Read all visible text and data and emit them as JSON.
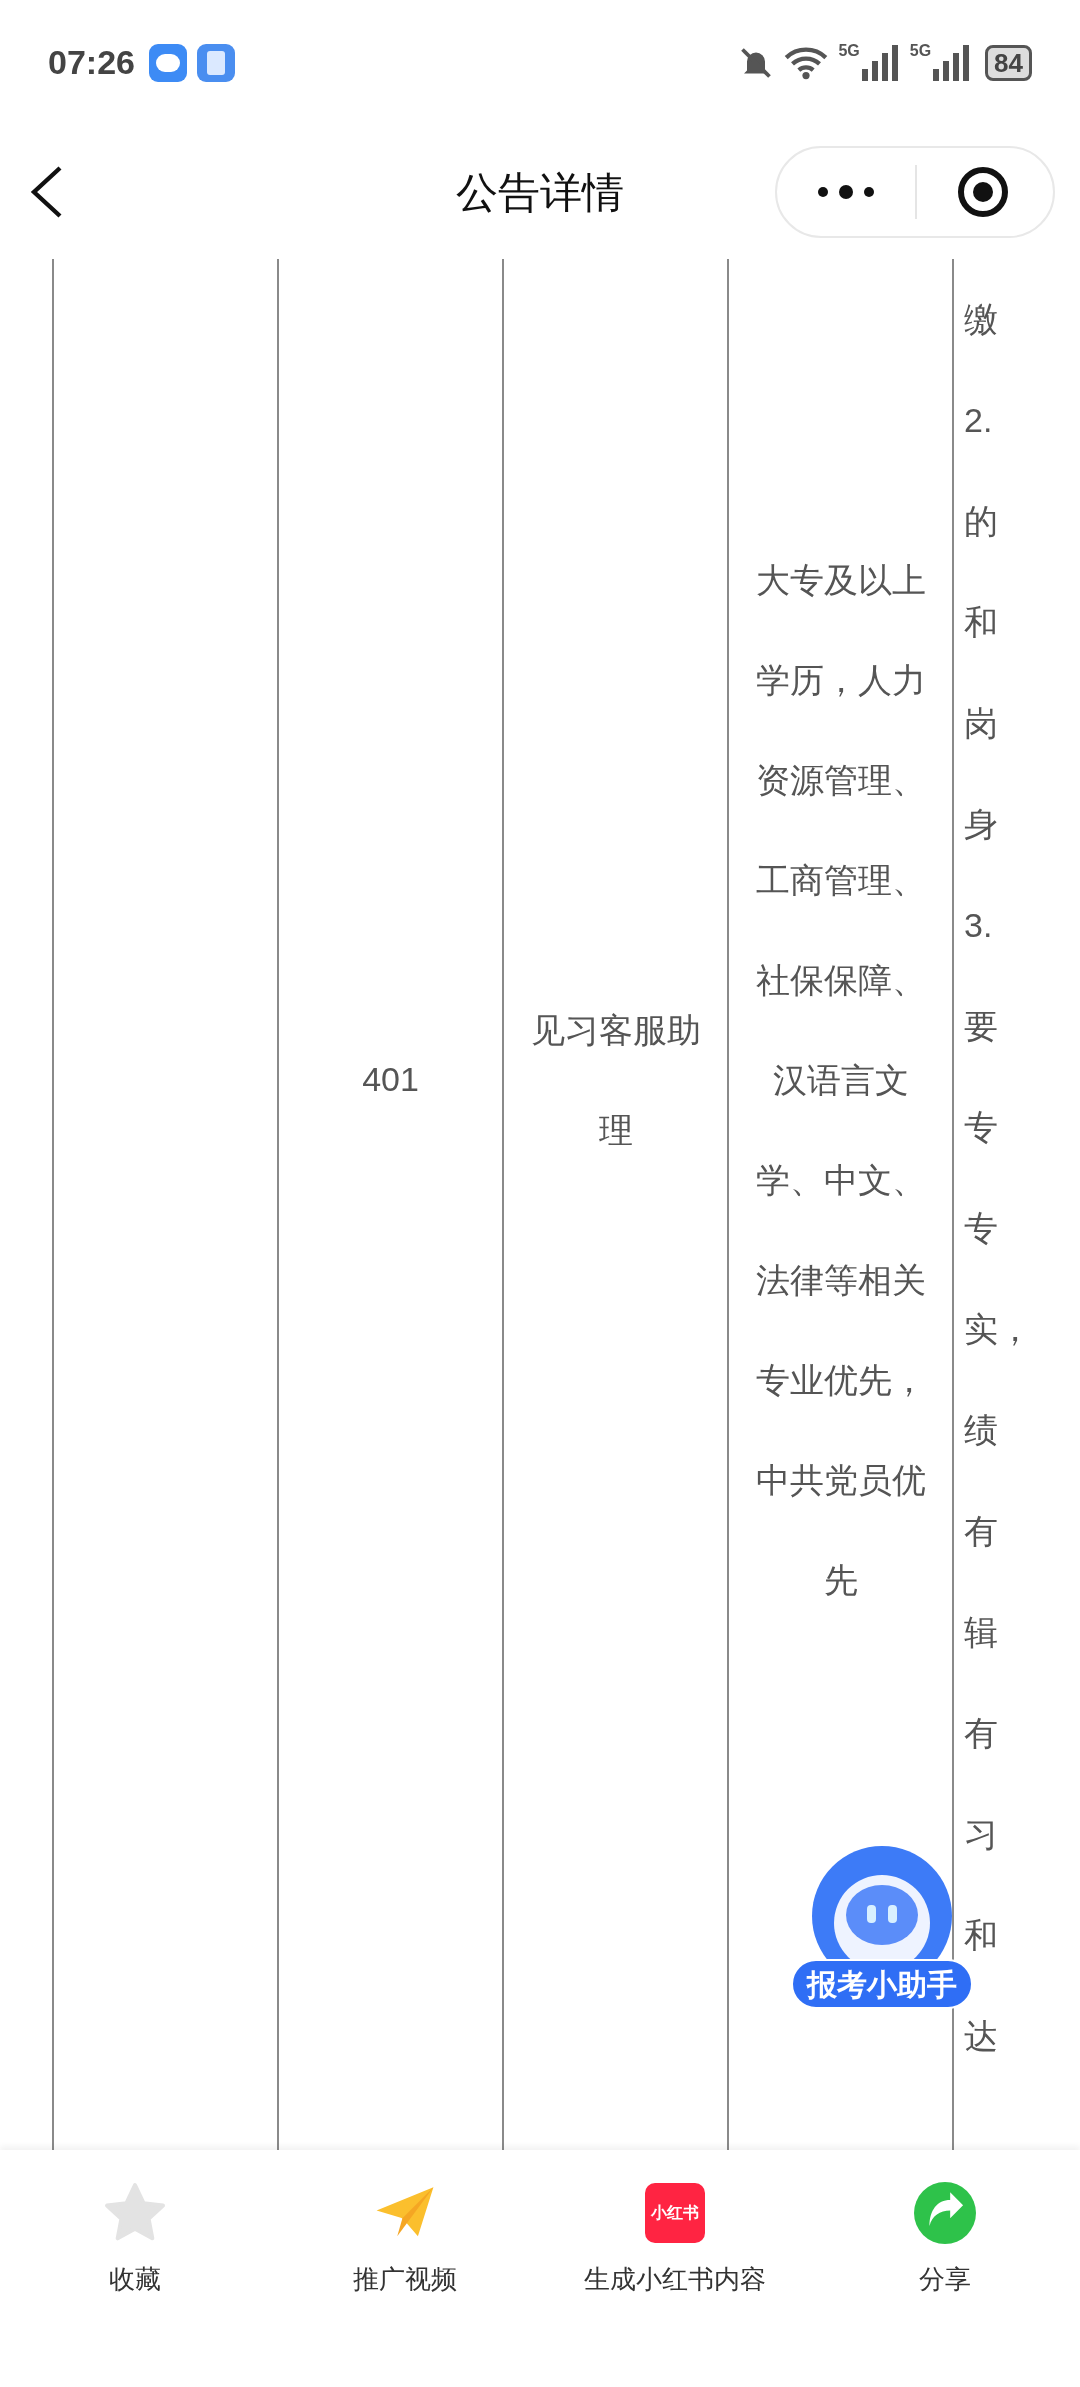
{
  "status_bar": {
    "time": "07:26",
    "battery": "84",
    "networks": [
      "5G",
      "5G"
    ]
  },
  "nav": {
    "title": "公告详情"
  },
  "table": {
    "column_3": "401",
    "column_4": "见习客服助理",
    "column_5": "大专及以上学历，人力资源管理、工商管理、社保保障、汉语言文学、中文、法律等相关专业优先，中共党员优先",
    "column_6": [
      "缴",
      "2.",
      "的",
      "和",
      "岗",
      "身",
      "3.",
      "要",
      "专",
      "专",
      "实，",
      "绩",
      "有",
      "辑",
      "有",
      "习",
      "和",
      "达"
    ]
  },
  "assistant": {
    "label": "报考小助手"
  },
  "bottom_bar": [
    {
      "kind": "star",
      "label": "收藏"
    },
    {
      "kind": "plane",
      "label": "推广视频"
    },
    {
      "kind": "logo",
      "logo_text": "小红书",
      "label": "生成小红书内容"
    },
    {
      "kind": "share",
      "label": "分享"
    }
  ]
}
